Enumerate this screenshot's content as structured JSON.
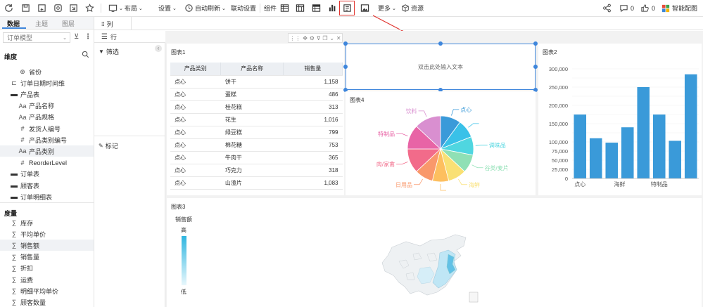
{
  "toolbar": {
    "layout_label": "布局",
    "settings_label": "设置",
    "auto_refresh_label": "自动刷新",
    "linkage_label": "联动设置",
    "components_label": "组件",
    "more_label": "更多",
    "resource_label": "资源",
    "comment_count": "0",
    "like_count": "0",
    "smart_config_label": "智能配图"
  },
  "left_panel": {
    "tabs": [
      "数据",
      "主题",
      "图层"
    ],
    "model_select": "订单模型",
    "dimension_header": "维度",
    "dimensions": [
      {
        "icon": "globe-icon",
        "glyph": "⊕",
        "label": "省份",
        "indent": 1
      },
      {
        "icon": "date-hierarchy-icon",
        "glyph": "⊏",
        "label": "订单日期时间维",
        "indent": 0
      },
      {
        "icon": "folder-icon",
        "glyph": "▬",
        "label": "产品表",
        "indent": 0
      },
      {
        "icon": "text-field-icon",
        "glyph": "Aa",
        "label": "产品名称",
        "indent": 1
      },
      {
        "icon": "text-field-icon",
        "glyph": "Aa",
        "label": "产品规格",
        "indent": 1
      },
      {
        "icon": "number-field-icon",
        "glyph": "#",
        "label": "发货人编号",
        "indent": 1
      },
      {
        "icon": "number-field-icon",
        "glyph": "#",
        "label": "产品类别编号",
        "indent": 1
      },
      {
        "icon": "text-field-icon",
        "glyph": "Aa",
        "label": "产品类别",
        "indent": 1
      },
      {
        "icon": "number-field-icon",
        "glyph": "#",
        "label": "ReorderLevel",
        "indent": 1
      },
      {
        "icon": "folder-icon",
        "glyph": "▬",
        "label": "订单表",
        "indent": 0
      },
      {
        "icon": "folder-icon",
        "glyph": "▬",
        "label": "顾客表",
        "indent": 0
      },
      {
        "icon": "folder-icon",
        "glyph": "▬",
        "label": "订单明细表",
        "indent": 0
      }
    ],
    "measure_header": "度量",
    "measures": [
      "库存",
      "平均单价",
      "销售额",
      "销售量",
      "折扣",
      "运费",
      "明细平均单价",
      "顾客数量"
    ]
  },
  "mid_panel": {
    "columns_label": "列",
    "rows_label": "行",
    "filter_label": "筛选",
    "marks_label": "标记"
  },
  "table_card": {
    "title": "图表1",
    "headers": [
      "产品类别",
      "产品名称",
      "销售量"
    ],
    "rows": [
      [
        "点心",
        "饼干",
        "1,158"
      ],
      [
        "点心",
        "蛋糕",
        "486"
      ],
      [
        "点心",
        "桂花糕",
        "313"
      ],
      [
        "点心",
        "花生",
        "1,016"
      ],
      [
        "点心",
        "绿豆糕",
        "799"
      ],
      [
        "点心",
        "棉花糖",
        "753"
      ],
      [
        "点心",
        "牛肉干",
        "365"
      ],
      [
        "点心",
        "巧克力",
        "318"
      ],
      [
        "点心",
        "山渣片",
        "1,083"
      ]
    ]
  },
  "text_card": {
    "placeholder": "双击此处输入文本"
  },
  "pie_card": {
    "title": "图表4"
  },
  "bar_card": {
    "title": "图表2"
  },
  "map_card": {
    "title": "图表3",
    "legend_title": "销售额",
    "legend_high": "高",
    "legend_low": "低"
  },
  "colors": {
    "accent": "#3e86dc",
    "bar": "#3a9ad9",
    "annotation": "#e0342f"
  },
  "chart_data": [
    {
      "type": "pie",
      "title": "",
      "slices": [
        {
          "name": "点心",
          "value": 10,
          "color": "#3a9ad9"
        },
        {
          "name": "",
          "value": 9,
          "color": "#39c1e8"
        },
        {
          "name": "调味品",
          "value": 9,
          "color": "#4fd6e0"
        },
        {
          "name": "谷类/麦片",
          "value": 9,
          "color": "#8fe0b5"
        },
        {
          "name": "海鲜",
          "value": 9,
          "color": "#f9e074"
        },
        {
          "name": "",
          "value": 8,
          "color": "#fdbf5f"
        },
        {
          "name": "日用品",
          "value": 9,
          "color": "#f9986b"
        },
        {
          "name": "肉/家禽",
          "value": 12,
          "color": "#f26b8a"
        },
        {
          "name": "特制品",
          "value": 12,
          "color": "#e864a6"
        },
        {
          "name": "饮料",
          "value": 13,
          "color": "#d98fd0"
        }
      ]
    },
    {
      "type": "bar",
      "title": "",
      "x_tick_labels": [
        "点心",
        "海鲜",
        "特制品"
      ],
      "values": [
        175000,
        110000,
        98000,
        140000,
        250000,
        175000,
        103000,
        285000
      ],
      "ylim": [
        0,
        300000
      ],
      "y_ticks": [
        "0",
        "25,000",
        "50,000",
        "75,000",
        "100,000",
        "150,000",
        "200,000",
        "250,000",
        "300,000"
      ],
      "color": "#3a9ad9"
    }
  ]
}
